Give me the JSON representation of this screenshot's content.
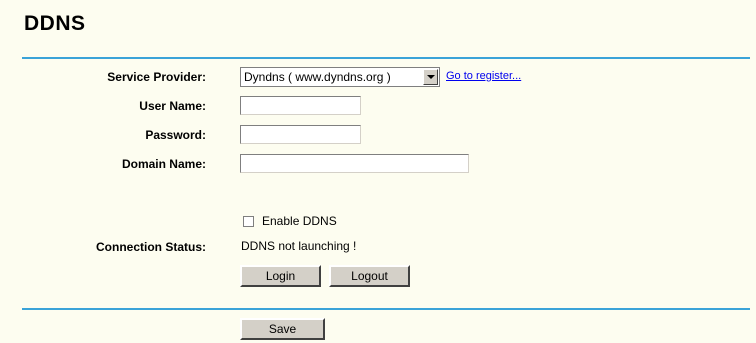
{
  "page": {
    "title": "DDNS"
  },
  "form": {
    "service_provider": {
      "label": "Service Provider:",
      "selected": "Dyndns ( www.dyndns.org )",
      "register_link": "Go to register..."
    },
    "user_name": {
      "label": "User Name:",
      "value": ""
    },
    "password": {
      "label": "Password:",
      "value": ""
    },
    "domain_name": {
      "label": "Domain Name:",
      "value": ""
    },
    "enable_ddns": {
      "label": "Enable DDNS",
      "checked": false
    },
    "connection_status": {
      "label": "Connection Status:",
      "value": "DDNS not launching !"
    },
    "buttons": {
      "login": "Login",
      "logout": "Logout",
      "save": "Save"
    }
  },
  "colors": {
    "accent_rule": "#3aa3d8",
    "background": "#fdfdf0",
    "link": "#0000ee"
  }
}
